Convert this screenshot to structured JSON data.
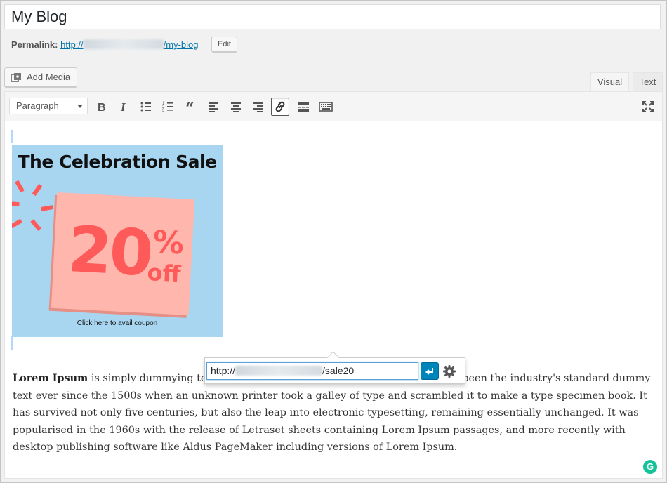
{
  "post": {
    "title": "My Blog",
    "permalink_label": "Permalink:",
    "permalink_prefix": "http://",
    "permalink_slug": "/my-blog",
    "edit_label": "Edit"
  },
  "media": {
    "add_media_label": "Add Media"
  },
  "tabs": {
    "visual": "Visual",
    "text": "Text",
    "active": "visual"
  },
  "toolbar": {
    "format_value": "Paragraph",
    "buttons": [
      "bold-icon",
      "italic-icon",
      "bulleted-list-icon",
      "numbered-list-icon",
      "blockquote-icon",
      "align-left-icon",
      "align-center-icon",
      "align-right-icon",
      "link-icon",
      "read-more-icon",
      "toolbar-toggle-icon",
      "fullscreen-icon"
    ],
    "active_button": "link-icon"
  },
  "image": {
    "title": "The Celebration Sale",
    "discount_number": "20",
    "discount_percent": "%",
    "discount_off": "off",
    "cta": "Click here to avail coupon",
    "colors": {
      "background": "#a8d6f0",
      "note": "#ffb6ad",
      "accent": "#ff5a5a"
    }
  },
  "link_popup": {
    "url_prefix": "http://",
    "url_suffix": "/sale20",
    "apply_icon": "enter-icon",
    "settings_icon": "gear-icon"
  },
  "paragraph": {
    "lead": "Lorem Ipsum",
    "line1": " is simply dummying te",
    "line1_tail": "psum has been the industry's standard",
    "rest": "dummy text ever since the 1500s when an unknown printer took a galley of type and scrambled it to make a type specimen book. It has survived not only five centuries, but also the leap into electronic typesetting, remaining essentially unchanged. It was popularised in the 1960s with the release of Letraset sheets containing Lorem Ipsum passages, and more recently with desktop publishing software like Aldus PageMaker including versions of Lorem Ipsum."
  },
  "accent_color": "#0073aa"
}
